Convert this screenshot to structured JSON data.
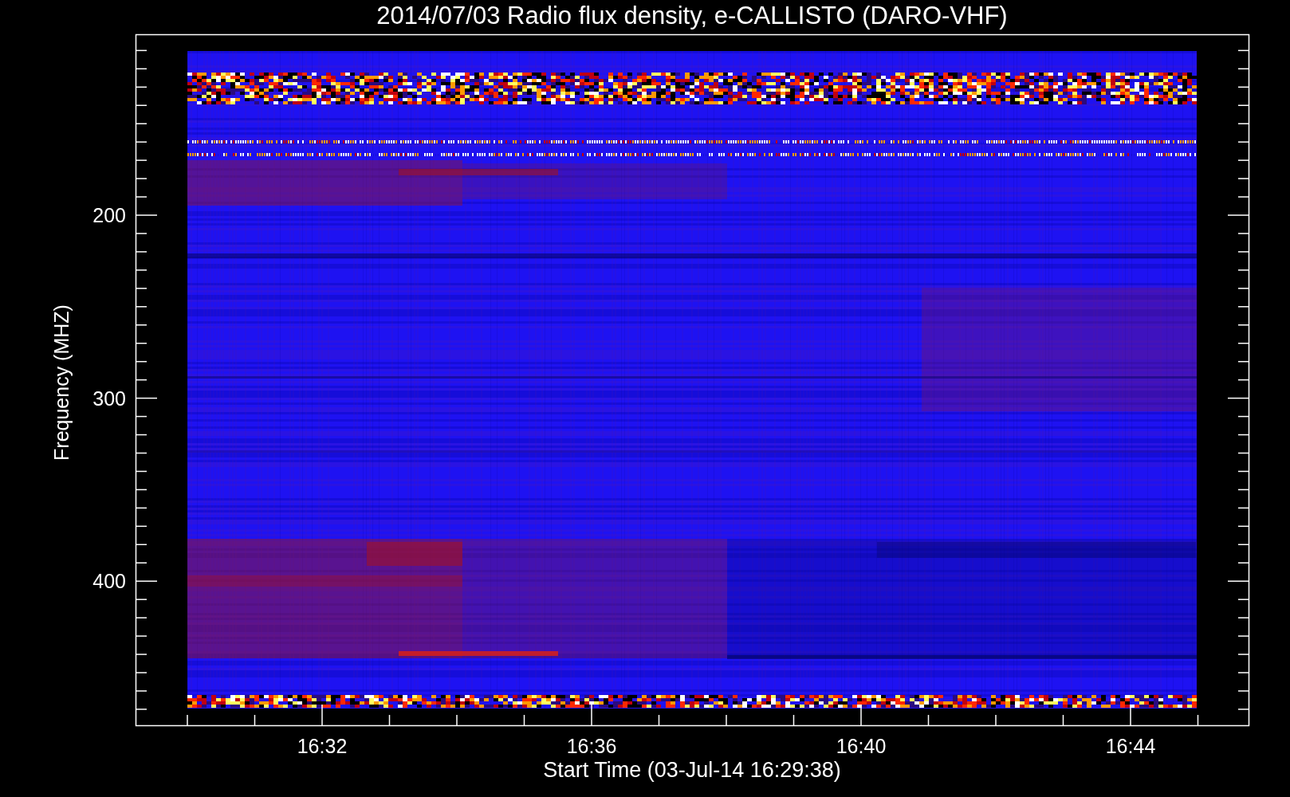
{
  "title": "2014/07/03  Radio flux density, e-CALLISTO (DARO-VHF)",
  "y_axis": {
    "label": "Frequency (MHZ)",
    "ticks": [
      "200",
      "300",
      "400"
    ]
  },
  "x_axis": {
    "label": "Start Time (03-Jul-14 16:29:38)",
    "ticks": [
      "16:32",
      "16:36",
      "16:40",
      "16:44"
    ]
  }
}
